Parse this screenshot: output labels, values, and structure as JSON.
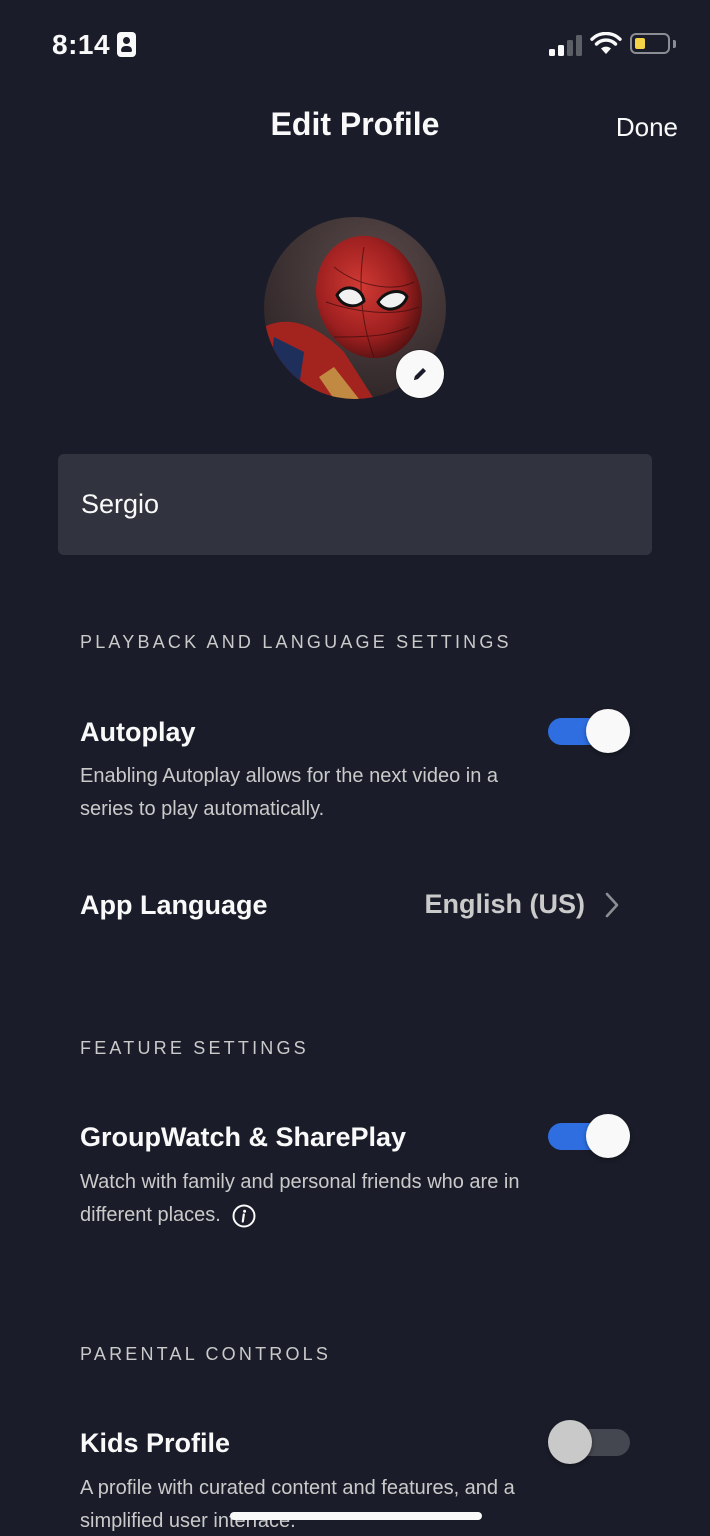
{
  "status_bar": {
    "time": "8:14",
    "battery_level": 0.3,
    "battery_color": "#f4d347",
    "signal_bars_active": 2,
    "icons": [
      "person-badge-icon",
      "cellular-signal-icon",
      "wifi-icon",
      "battery-icon"
    ]
  },
  "nav": {
    "title": "Edit Profile",
    "done_label": "Done"
  },
  "avatar": {
    "image": "spider-man-avatar",
    "edit_icon": "pencil-icon"
  },
  "name_field": {
    "value": "Sergio"
  },
  "sections": {
    "playback": {
      "header": "PLAYBACK AND LANGUAGE SETTINGS",
      "autoplay": {
        "title": "Autoplay",
        "description": "Enabling Autoplay allows for the next video in a series to play automatically.",
        "enabled": true
      },
      "app_language": {
        "title": "App Language",
        "value": "English (US)",
        "icon": "chevron-right-icon"
      }
    },
    "features": {
      "header": "FEATURE SETTINGS",
      "groupwatch": {
        "title": "GroupWatch & SharePlay",
        "description": "Watch with family and personal friends who are in different places.",
        "enabled": true,
        "icon": "info-icon"
      }
    },
    "parental": {
      "header": "PARENTAL CONTROLS",
      "kids_profile": {
        "title": "Kids Profile",
        "description": "A profile with curated content and features, and a simplified user interface.",
        "enabled": false
      }
    }
  },
  "colors": {
    "background": "#1a1d29",
    "field": "#31343e",
    "toggle_on": "#2e6ee0",
    "toggle_off": "#44474f",
    "text_primary": "#f9f9f9",
    "text_secondary": "#cacaca"
  }
}
